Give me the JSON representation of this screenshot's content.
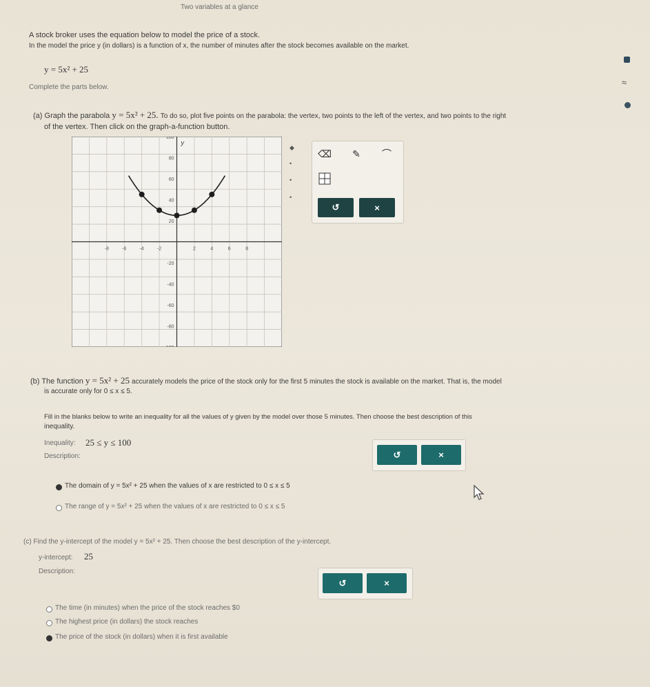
{
  "header": {
    "title": "Two variables at a glance"
  },
  "intro": {
    "line1": "A stock broker uses the equation below to model the price of a stock.",
    "line2": "In the model the price y (in dollars) is a function of x, the number of minutes after the stock becomes available on the market.",
    "equation": "y = 5x² + 25",
    "instruction": "Complete the parts below."
  },
  "part_a": {
    "label": "(a)",
    "text1_pre": "Graph the parabola",
    "equation": "y = 5x² + 25.",
    "text1_post": "To do so, plot five points on the parabola: the vertex, two points to the left of the vertex, and two points to the right",
    "text2": "of the vertex. Then click on the graph-a-function button.",
    "graph": {
      "x_ticks": [
        "-8",
        "-6",
        "-4",
        "-2",
        "2",
        "4",
        "6",
        "8"
      ],
      "y_ticks": [
        "100",
        "80",
        "60",
        "40",
        "20",
        "-20",
        "-40",
        "-60",
        "-80",
        "-100"
      ],
      "points": [
        [
          -2,
          45
        ],
        [
          -1,
          30
        ],
        [
          0,
          25
        ],
        [
          1,
          30
        ],
        [
          2,
          45
        ]
      ]
    },
    "toolbar": {
      "undo_label": "↺",
      "clear_label": "×"
    }
  },
  "part_b": {
    "label": "(b)",
    "text1_pre": "The function",
    "equation": "y = 5x² + 25",
    "text1_post": "accurately models the price of the stock only for the first 5 minutes the stock is available on the market. That is, the model",
    "text2": "is accurate only for 0 ≤ x ≤ 5.",
    "text3": "Fill in the blanks below to write an inequality for all the values of y given by the model over those 5 minutes. Then choose the best description of this",
    "text4": "inequality.",
    "inequality_label": "Inequality:",
    "inequality_value": "25 ≤ y ≤ 100",
    "description_label": "Description:",
    "options": [
      "The domain of y = 5x² + 25 when the values of x are restricted to 0 ≤ x ≤ 5",
      "The range of y = 5x² + 25 when the values of x are restricted to 0 ≤ x ≤ 5"
    ],
    "selected_option": 0,
    "undo_label": "↺",
    "clear_label": "×"
  },
  "part_c": {
    "label": "(c)",
    "text1": "Find the y-intercept of the model y = 5x² + 25. Then choose the best description of the y-intercept.",
    "intercept_label": "y-intercept:",
    "intercept_value": "25",
    "description_label": "Description:",
    "options": [
      "The time (in minutes) when the price of the stock reaches $0",
      "The highest price (in dollars) the stock reaches",
      "The price of the stock (in dollars) when it is first available"
    ],
    "selected_option": 2,
    "undo_label": "↺",
    "clear_label": "×"
  },
  "colors": {
    "accent": "#1f4343",
    "point": "#1e1e1e",
    "grid": "#c7c3bb"
  }
}
